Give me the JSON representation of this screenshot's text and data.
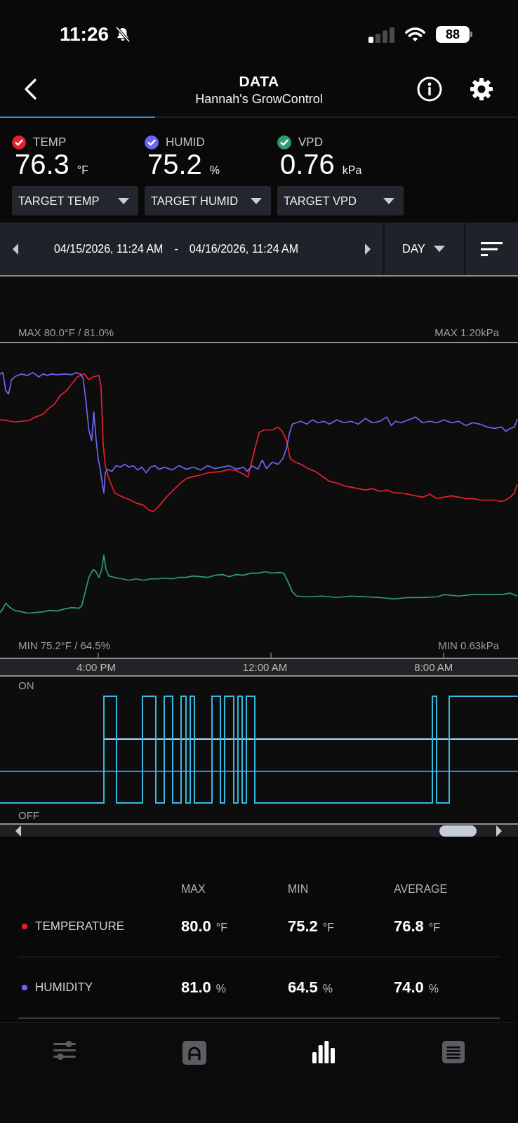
{
  "status_bar": {
    "time": "11:26",
    "battery": "88"
  },
  "header": {
    "title": "DATA",
    "subtitle": "Hannah's GrowControl",
    "progress": {
      "level": 0.3
    }
  },
  "readings": [
    {
      "label": "TEMP",
      "value": "76.3",
      "unit": "°F",
      "color": "#e5202e",
      "checked": true
    },
    {
      "label": "HUMID",
      "value": "75.2",
      "unit": "%",
      "color": "#6d65f3",
      "checked": true
    },
    {
      "label": "VPD",
      "value": "0.76",
      "unit": "kPa",
      "color": "#2f9c6b",
      "checked": true
    }
  ],
  "targets": [
    {
      "label": "TARGET TEMP"
    },
    {
      "label": "TARGET HUMID"
    },
    {
      "label": "TARGET VPD"
    }
  ],
  "date_range": {
    "start": "04/15/2026, 11:24 AM",
    "separator": "-",
    "end": "04/16/2026, 11:24 AM",
    "period": "DAY"
  },
  "chart": {
    "max_left": "MAX 80.0°F / 81.0%",
    "max_right": "MAX 1.20kPa",
    "min_left": "MIN 75.2°F / 64.5%",
    "min_right": "MIN 0.63kPa",
    "time_labels": [
      "4:00 PM",
      "12:00 AM",
      "8:00 AM"
    ]
  },
  "output_chart": {
    "on_label": "ON",
    "off_label": "OFF"
  },
  "stats": {
    "columns": [
      "MAX",
      "MIN",
      "AVERAGE"
    ],
    "rows": [
      {
        "label": "TEMPERATURE",
        "color": "#e5202e",
        "cells": [
          {
            "value": "80.0",
            "unit": "°F"
          },
          {
            "value": "75.2",
            "unit": "°F"
          },
          {
            "value": "76.8",
            "unit": "°F"
          }
        ]
      },
      {
        "label": "HUMIDITY",
        "color": "#6d65f3",
        "cells": [
          {
            "value": "81.0",
            "unit": "%"
          },
          {
            "value": "64.5",
            "unit": "%"
          },
          {
            "value": "74.0",
            "unit": "%"
          }
        ]
      }
    ]
  },
  "tab_bar": {
    "tabs": [
      {
        "selected": false
      },
      {
        "selected": false
      },
      {
        "selected": true
      },
      {
        "selected": false
      }
    ]
  }
}
